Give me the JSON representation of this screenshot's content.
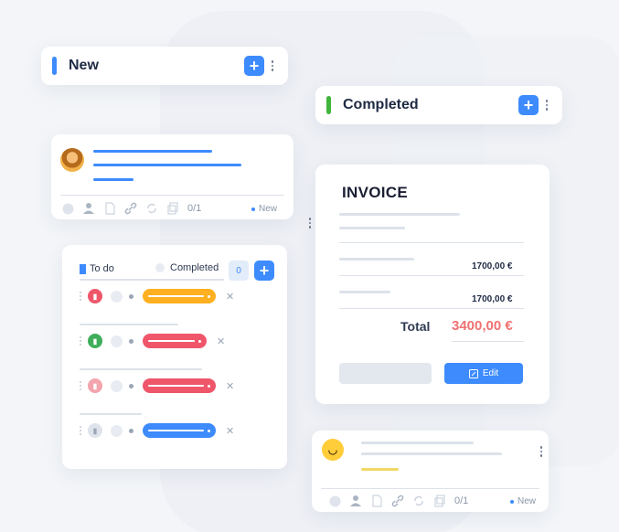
{
  "columns": {
    "new": {
      "title": "New",
      "bar_color": "#3d8bfd"
    },
    "completed": {
      "title": "Completed",
      "bar_color": "#40b53b"
    }
  },
  "task_card": {
    "count": "0/1",
    "status": "New"
  },
  "todo_card": {
    "todo_label": "To do",
    "completed_label": "Completed",
    "counter": "0",
    "rows": [
      {
        "status_color": "#f0566a",
        "pill_color": "#ffb020"
      },
      {
        "status_color": "#3fae5a",
        "pill_color": "#f0566a"
      },
      {
        "status_color": "#f4a4ad",
        "pill_color": "#f0566a"
      },
      {
        "status_color": "#dfe4ec",
        "pill_color": "#3d8bfd"
      }
    ]
  },
  "invoice": {
    "title": "INVOICE",
    "amount_1": "1700,00  €",
    "amount_2": "1700,00  €",
    "total_label": "Total",
    "total_value": "3400,00 €",
    "edit_label": "Edit"
  },
  "comment_card": {
    "count": "0/1",
    "status": "New"
  }
}
